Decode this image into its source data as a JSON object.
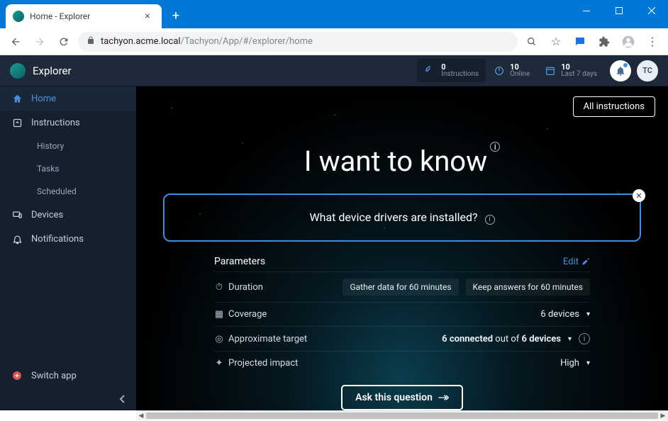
{
  "browser": {
    "tab_title": "Home - Explorer",
    "url_host": "tachyon.acme.local",
    "url_path": "/Tachyon/App/#/explorer/home"
  },
  "header": {
    "brand": "Explorer",
    "stats": [
      {
        "num": "0",
        "label": "Instructions"
      },
      {
        "num": "10",
        "label": "Online"
      },
      {
        "num": "10",
        "label": "Last 7 days"
      }
    ],
    "avatar": "TC"
  },
  "sidebar": {
    "items": [
      {
        "label": "Home",
        "active": true
      },
      {
        "label": "Instructions"
      },
      {
        "label": "History",
        "sub": true
      },
      {
        "label": "Tasks",
        "sub": true
      },
      {
        "label": "Scheduled",
        "sub": true
      },
      {
        "label": "Devices"
      },
      {
        "label": "Notifications"
      }
    ],
    "switch": "Switch app"
  },
  "main": {
    "all_instructions": "All instructions",
    "hero": "I want to know",
    "question": "What device drivers are installed?",
    "params_title": "Parameters",
    "edit": "Edit",
    "rows": {
      "duration_label": "Duration",
      "duration_gather": "Gather data for 60 minutes",
      "duration_keep": "Keep answers for 60 minutes",
      "coverage_label": "Coverage",
      "coverage_value": "6 devices",
      "target_label": "Approximate target",
      "target_connected": "6 connected",
      "target_outof": " out of ",
      "target_devices": "6 devices",
      "impact_label": "Projected impact",
      "impact_value": "High"
    },
    "ask": "Ask this question"
  }
}
